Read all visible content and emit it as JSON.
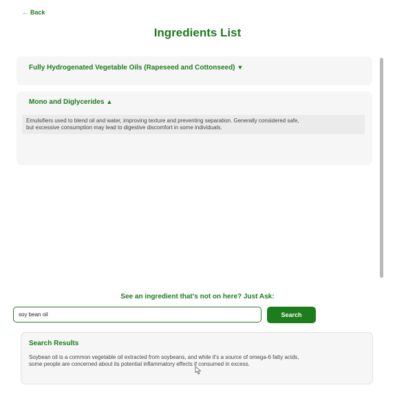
{
  "nav": {
    "back_label": "Back",
    "back_icon": "left-arrow-icon"
  },
  "page": {
    "title": "Ingredients List"
  },
  "ingredients": [
    {
      "name": "Fully Hydrogenated Vegetable Oils (Rapeseed and Cottonseed)",
      "toggle": "▼",
      "expanded": false
    },
    {
      "name": "Mono and Diglycerides",
      "toggle": "▲",
      "expanded": true,
      "description_line1": "Emulsifiers used to blend oil and water, improving texture and preventing separation. Generally considered safe,",
      "description_line2": "but excessive consumption may lead to digestive discomfort in some individuals."
    }
  ],
  "ask": {
    "label": "See an ingredient that's not on here? Just Ask:",
    "input_value": "soy bean oil",
    "button_label": "Search"
  },
  "results": {
    "title": "Search Results",
    "line1": "Soybean oil is a common vegetable oil extracted from soybeans, and while it's a source of omega-6 fatty acids,",
    "line2": "some people are concerned about its potential inflammatory effects if consumed in excess."
  },
  "colors": {
    "accent": "#1e7a1e",
    "button": "#1b7d1b",
    "card": "#f6f6f6"
  }
}
